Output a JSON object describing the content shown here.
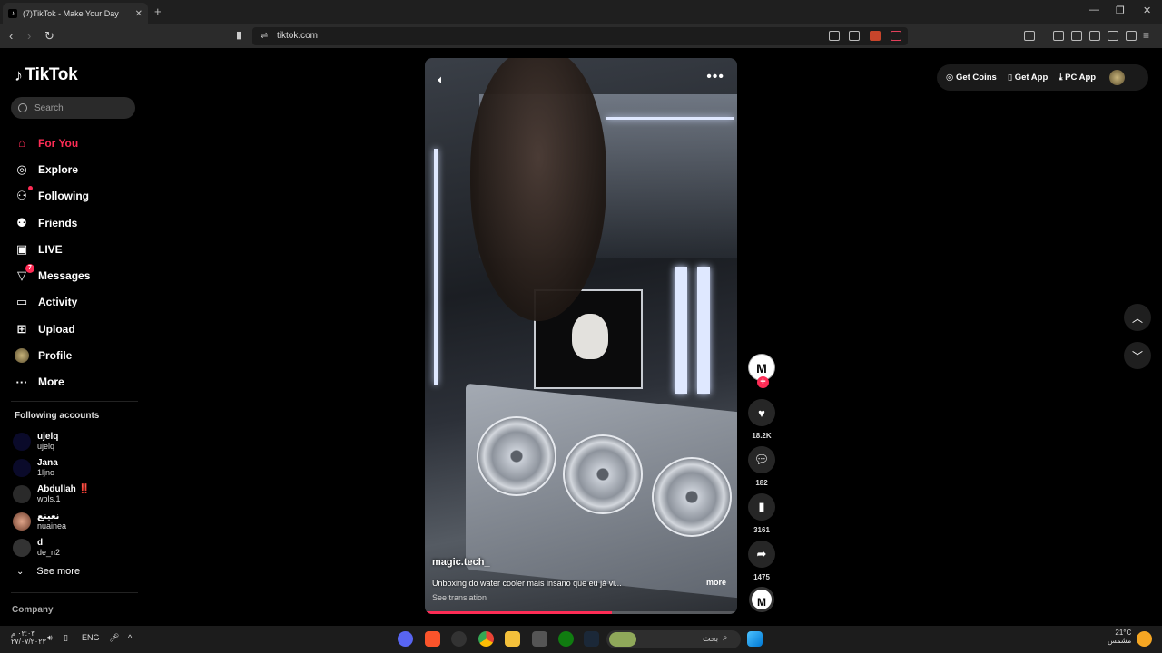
{
  "browser": {
    "tab_title": "(7)TikTok - Make Your Day",
    "url": "tiktok.com"
  },
  "colors": {
    "accent": "#fe2c55",
    "background": "#000000"
  },
  "sidebar": {
    "logo": "TikTok",
    "search_placeholder": "Search",
    "nav": [
      {
        "label": "For You",
        "icon": "home-icon",
        "active": true
      },
      {
        "label": "Explore",
        "icon": "compass-icon"
      },
      {
        "label": "Following",
        "icon": "following-icon"
      },
      {
        "label": "Friends",
        "icon": "friends-icon"
      },
      {
        "label": "LIVE",
        "icon": "live-icon"
      },
      {
        "label": "Messages",
        "icon": "messages-icon",
        "badge": "7"
      },
      {
        "label": "Activity",
        "icon": "activity-icon"
      },
      {
        "label": "Upload",
        "icon": "upload-icon"
      },
      {
        "label": "Profile",
        "icon": "avatar"
      },
      {
        "label": "More",
        "icon": "more-icon"
      }
    ],
    "following_title": "Following accounts",
    "accounts": [
      {
        "name": "ujelq",
        "handle": "ujelq"
      },
      {
        "name": "Jana",
        "handle": "1ljno"
      },
      {
        "name": "Abdullah ‼️",
        "handle": "wbls.1"
      },
      {
        "name": "نعينع",
        "handle": "nuainea"
      },
      {
        "name": "d",
        "handle": "de_n2"
      }
    ],
    "see_more": "See more",
    "company": "Company"
  },
  "video": {
    "author": "magic.tech_",
    "caption": "Unboxing do water cooler mais insano que eu já vi...",
    "more": "more",
    "see_translation": "See translation",
    "progress": 0.6
  },
  "actions": {
    "creator_initial": "M",
    "likes": "18.2K",
    "comments": "182",
    "saves": "3161",
    "shares": "1475"
  },
  "topbar": {
    "get_coins": "Get Coins",
    "get_app": "Get App",
    "pc_app": "PC App"
  },
  "taskbar": {
    "time": "٠٢:٠٣ م",
    "date": "٢٧/٠٧/٢٠٢٣",
    "lang": "ENG",
    "search_text": "بحث",
    "weather_temp": "21°C",
    "weather_desc": "مشمس"
  }
}
